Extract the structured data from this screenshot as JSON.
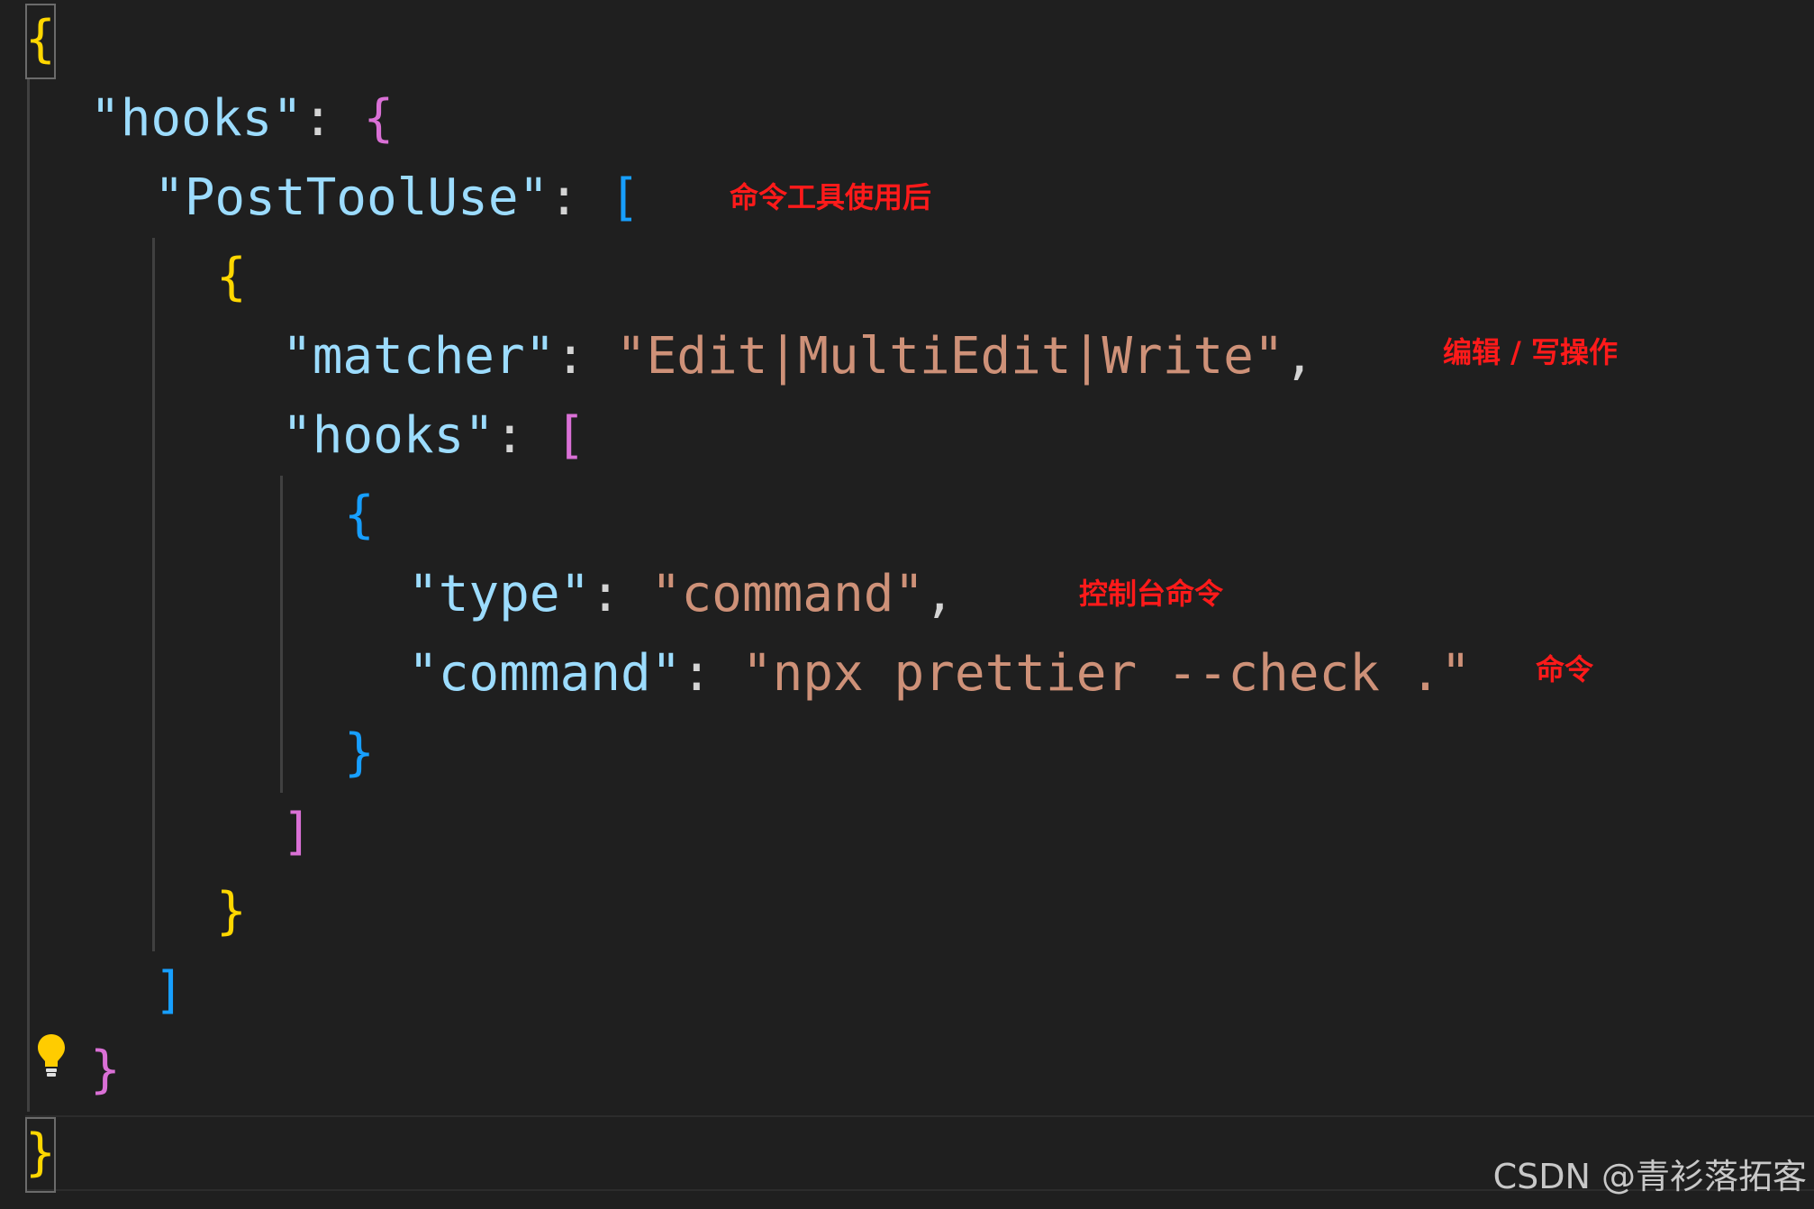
{
  "code": {
    "line1": {
      "brace_open": "{"
    },
    "line2": {
      "key": "\"hooks\"",
      "colon": ": ",
      "bracket": "{"
    },
    "line3": {
      "key": "\"PostToolUse\"",
      "colon": ": ",
      "bracket": "["
    },
    "line4": {
      "bracket": "{"
    },
    "line5": {
      "key": "\"matcher\"",
      "colon": ": ",
      "value": "\"Edit|MultiEdit|Write\"",
      "comma": ","
    },
    "line6": {
      "key": "\"hooks\"",
      "colon": ": ",
      "bracket": "["
    },
    "line7": {
      "bracket": "{"
    },
    "line8": {
      "key": "\"type\"",
      "colon": ": ",
      "value": "\"command\"",
      "comma": ","
    },
    "line9": {
      "key": "\"command\"",
      "colon": ": ",
      "value": "\"npx prettier --check .\""
    },
    "line10": {
      "bracket": "}"
    },
    "line11": {
      "bracket": "]"
    },
    "line12": {
      "bracket": "}"
    },
    "line13": {
      "bracket": "]"
    },
    "line14": {
      "bracket": "}"
    },
    "line15": {
      "brace_close": "}"
    }
  },
  "annotations": {
    "post_tool_use": "命令工具使用后",
    "matcher": "编辑 / 写操作",
    "type": "控制台命令",
    "command": "命令"
  },
  "icons": {
    "lightbulb": "lightbulb-icon"
  },
  "watermark": "CSDN @青衫落拓客",
  "colors": {
    "background": "#1f1f1f",
    "json_key": "#9cdcfe",
    "json_string": "#ce9178",
    "bracket_level1": "#ffd700",
    "bracket_level2": "#da70d6",
    "bracket_level3": "#179fff",
    "annotation": "#ff1a1a"
  }
}
